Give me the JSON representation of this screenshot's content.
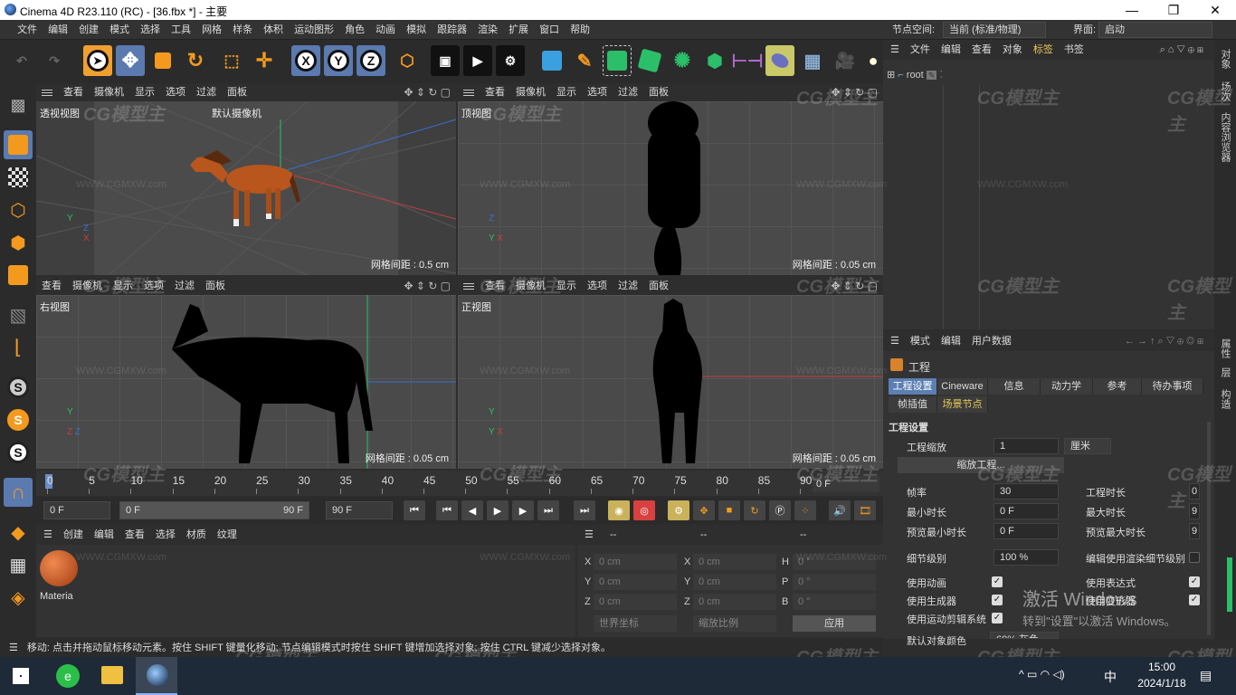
{
  "window": {
    "title": "Cinema 4D R23.110 (RC) - [36.fbx *] - 主要",
    "min": "—",
    "max": "❐",
    "close": "✕"
  },
  "menu": [
    "文件",
    "编辑",
    "创建",
    "模式",
    "选择",
    "工具",
    "网格",
    "样条",
    "体积",
    "运动图形",
    "角色",
    "动画",
    "模拟",
    "跟踪器",
    "渲染",
    "扩展",
    "窗口",
    "帮助"
  ],
  "node_space": {
    "label": "节点空间:",
    "value": "当前 (标准/物理)"
  },
  "interface": {
    "label": "界面:",
    "value": "启动"
  },
  "viewport_menu": [
    "查看",
    "摄像机",
    "显示",
    "选项",
    "过滤",
    "面板"
  ],
  "viewports": {
    "perspective": {
      "label": "透视视图",
      "camera": "默认摄像机",
      "grid": "网格间距 : 0.5 cm"
    },
    "top": {
      "label": "顶视图",
      "grid": "网格间距 : 0.05 cm"
    },
    "right": {
      "label": "右视图",
      "grid": "网格间距 : 0.05 cm"
    },
    "front": {
      "label": "正视图",
      "grid": "网格间距 : 0.05 cm"
    }
  },
  "timeline": {
    "ticks": [
      "0",
      "5",
      "10",
      "15",
      "20",
      "25",
      "30",
      "35",
      "40",
      "45",
      "50",
      "55",
      "60",
      "65",
      "70",
      "75",
      "80",
      "85",
      "90"
    ],
    "current": "0 F"
  },
  "transport": {
    "start": "0 F",
    "range_start": "0 F",
    "range_end": "90 F",
    "end": "90 F"
  },
  "material_panel": {
    "menu": [
      "创建",
      "编辑",
      "查看",
      "选择",
      "材质",
      "纹理"
    ],
    "material_name": "Materia"
  },
  "coord_panel": {
    "header": [
      "--",
      "--",
      "--"
    ],
    "rows": [
      {
        "a": "X",
        "av": "0 cm",
        "b": "X",
        "bv": "0 cm",
        "c": "H",
        "cv": "0 °"
      },
      {
        "a": "Y",
        "av": "0 cm",
        "b": "Y",
        "bv": "0 cm",
        "c": "P",
        "cv": "0 °"
      },
      {
        "a": "Z",
        "av": "0 cm",
        "b": "Z",
        "bv": "0 cm",
        "c": "B",
        "cv": "0 °"
      }
    ],
    "world": "世界坐标",
    "scale": "缩放比例",
    "apply": "应用"
  },
  "status": "移动: 点击并拖动鼠标移动元素。按住 SHIFT 键量化移动; 节点编辑模式时按住 SHIFT 键增加选择对象; 按住 CTRL 键减少选择对象。",
  "object_manager": {
    "menu": [
      "文件",
      "编辑",
      "查看",
      "对象",
      "标签",
      "书签"
    ],
    "root": "root"
  },
  "attributes": {
    "menu": [
      "模式",
      "编辑",
      "用户数据"
    ],
    "title": "工程",
    "tabs_row1": [
      "工程设置",
      "Cineware",
      "信息",
      "动力学",
      "参考",
      "待办事项"
    ],
    "tabs_row2": [
      "帧插值",
      "场景节点"
    ],
    "section": "工程设置",
    "scale_label": "工程缩放",
    "scale_value": "1",
    "scale_unit": "厘米",
    "scale_button": "缩放工程...",
    "fps_label": "帧率",
    "fps_value": "30",
    "duration_label": "工程时长",
    "duration_value": "0",
    "min_label": "最小时长",
    "min_value": "0 F",
    "max_label": "最大时长",
    "max_value": "9",
    "pmin_label": "预览最小时长",
    "pmin_value": "0 F",
    "pmax_label": "预览最大时长",
    "pmax_value": "9",
    "lod_label": "细节级别",
    "lod_value": "100 %",
    "render_lod_label": "编辑使用渲染细节级别",
    "use_anim": "使用动画",
    "use_expr": "使用表达式",
    "use_gen": "使用生成器",
    "use_deform": "使用变形器",
    "use_motion": "使用运动剪辑系统",
    "default_color_label": "默认对象颜色",
    "default_color_value": "60% 灰色"
  },
  "right_side_tabs": [
    "对象",
    "场次",
    "内容浏览器",
    "属性",
    "层",
    "构造"
  ],
  "activation": {
    "line1": "激活 Windows",
    "line2": "转到\"设置\"以激活 Windows。"
  },
  "taskbar": {
    "time": "15:00",
    "date": "2024/1/18",
    "ime": "中"
  },
  "watermark": {
    "logo": "CG模型主",
    "url": "WWW.CGMXW.com"
  }
}
